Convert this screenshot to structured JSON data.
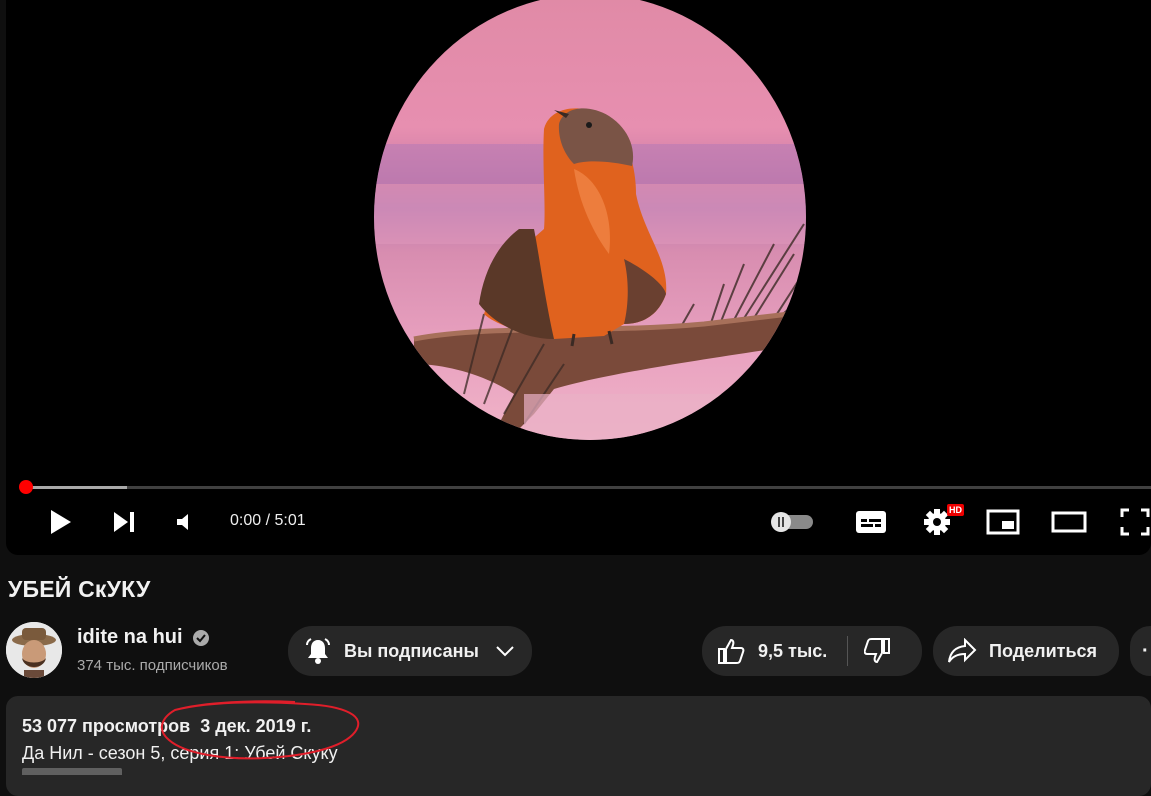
{
  "player": {
    "time_current": "0:00",
    "time_separator": " / ",
    "time_total": "5:01",
    "progress_played": 0.0,
    "progress_buffered": 0.09,
    "hd_badge": "HD",
    "accent_color": "#ff0000",
    "icons": [
      "play-icon",
      "next-icon",
      "volume-icon",
      "autoplay-toggle",
      "subtitles-icon",
      "settings-icon",
      "miniplayer-icon",
      "theater-icon",
      "fullscreen-icon"
    ]
  },
  "video": {
    "title": "УБЕЙ СкУКУ"
  },
  "channel": {
    "name": "idite na hui",
    "subscribers": "374 тыс. подписчиков",
    "subscribed_label": "Вы подписаны"
  },
  "actions": {
    "likes": "9,5 тыс.",
    "share_label": "Поделиться"
  },
  "description": {
    "views": "53 077 просмотров",
    "date": "3 дек. 2019 г.",
    "line1": "Да Нил - сезон 5, серия 1: Убей Скуку",
    "annotation_color": "#e01e2a"
  }
}
